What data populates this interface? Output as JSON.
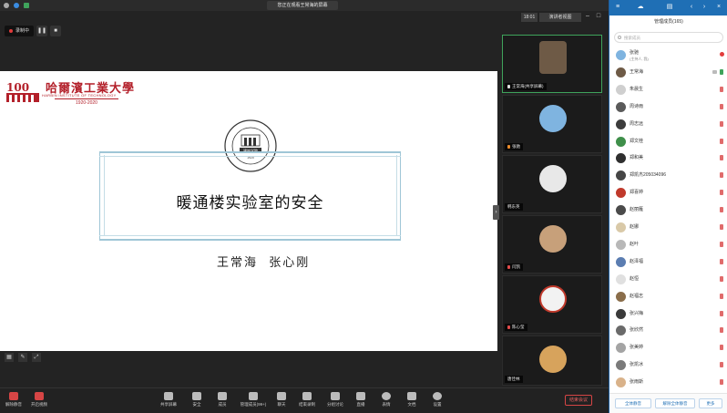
{
  "window": {
    "notice": "您正在观看王常海的屏幕"
  },
  "view": {
    "time": "18:01",
    "view_label": "演讲者视图"
  },
  "recording": {
    "label": "录制中"
  },
  "slide": {
    "school_cn": "哈爾濱工業大學",
    "school_en": "HARBIN INSTITUTE OF TECHNOLOGY",
    "years": "1920-2020",
    "anniversary": "100",
    "seal_text": "建筑学院",
    "seal_year": "1920",
    "title": "暖通楼实验室的安全",
    "authors": "王常海  张心刚"
  },
  "tiles": [
    {
      "name": "王常海(共享屏幕)",
      "color": "#6e5a46",
      "muted": false
    },
    {
      "name": "张驰",
      "color": "#7fb4e0",
      "muted": true
    },
    {
      "name": "韩东英",
      "color": "#e8e8e8",
      "muted": true
    },
    {
      "name": "闫凯",
      "color": "#c7a07a",
      "muted": true
    },
    {
      "name": "陈心莹",
      "color": "#f2f2f2",
      "muted": true
    },
    {
      "name": "唐佳林",
      "color": "#d7a35c",
      "muted": true
    }
  ],
  "toolbar": {
    "mute": "解除静音",
    "video": "开启视频",
    "share": "共享屏幕",
    "security": "安全",
    "members": "成员",
    "manage": "管理成员(99+)",
    "chat": "聊天",
    "record": "结束录制",
    "breakout": "分组讨论",
    "live": "直播",
    "react": "表情",
    "docs": "文档",
    "settings": "设置",
    "leave": "结束会议"
  },
  "panel": {
    "title": "管理成员(165)",
    "search_placeholder": "搜索成员",
    "members": [
      {
        "name": "张驰",
        "sub": "(主持人, 我)",
        "color": "#7fb4e0",
        "mic": "rec"
      },
      {
        "name": "王常海",
        "sub": "",
        "color": "#6e5a46",
        "mic": "on"
      },
      {
        "name": "朱晨生",
        "sub": "",
        "color": "#cfcfcf",
        "mic": "off"
      },
      {
        "name": "周诗雨",
        "sub": "",
        "color": "#5a5a5a",
        "mic": "off"
      },
      {
        "name": "周志远",
        "sub": "",
        "color": "#3c3c3c",
        "mic": "off"
      },
      {
        "name": "郑文桂",
        "sub": "",
        "color": "#3f8f4a",
        "mic": "off"
      },
      {
        "name": "郑和美",
        "sub": "",
        "color": "#2f2f2f",
        "mic": "off"
      },
      {
        "name": "郑凯杰205034096",
        "sub": "",
        "color": "#454545",
        "mic": "off"
      },
      {
        "name": "郑喜婷",
        "sub": "",
        "color": "#c0392b",
        "mic": "off"
      },
      {
        "name": "赵丽雁",
        "sub": "",
        "color": "#4a4a4a",
        "mic": "off"
      },
      {
        "name": "赵娜",
        "sub": "",
        "color": "#d9c9a8",
        "mic": "off"
      },
      {
        "name": "赵叶",
        "sub": "",
        "color": "#b8b8b8",
        "mic": "off"
      },
      {
        "name": "赵泽福",
        "sub": "",
        "color": "#5b7db1",
        "mic": "off"
      },
      {
        "name": "赵恒",
        "sub": "",
        "color": "#e0e0e0",
        "mic": "off"
      },
      {
        "name": "赵福志",
        "sub": "",
        "color": "#8a6d4a",
        "mic": "off"
      },
      {
        "name": "张兴梅",
        "sub": "",
        "color": "#3a3a3a",
        "mic": "off"
      },
      {
        "name": "张欣然",
        "sub": "",
        "color": "#6a6a6a",
        "mic": "off"
      },
      {
        "name": "张美婷",
        "sub": "",
        "color": "#a4a4a4",
        "mic": "off"
      },
      {
        "name": "张凯冰",
        "sub": "",
        "color": "#7a7a7a",
        "mic": "off"
      },
      {
        "name": "张雨斯",
        "sub": "",
        "color": "#d9b28a",
        "mic": "off"
      }
    ],
    "mute_all": "全体静音",
    "unmute_all": "解除全体静音",
    "more": "更多"
  }
}
